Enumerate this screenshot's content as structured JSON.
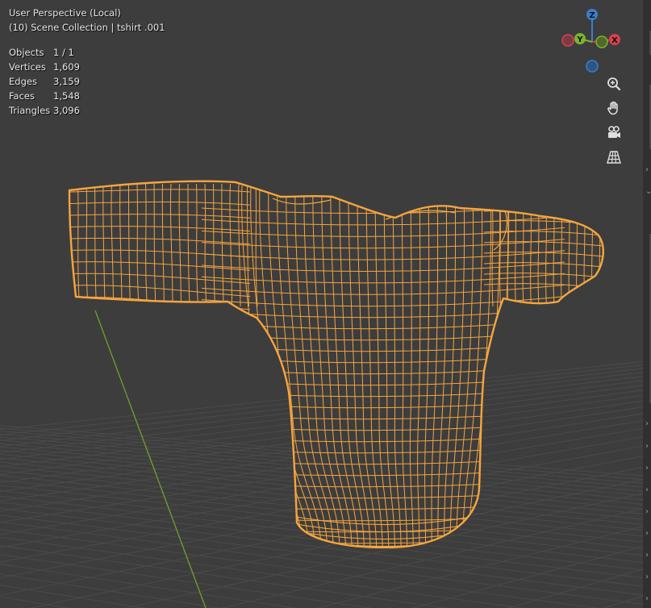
{
  "viewport": {
    "view_name": "User Perspective (Local)",
    "collection_info": "(10) Scene Collection | tshirt .001"
  },
  "stats": [
    {
      "label": "Objects",
      "value": "1 / 1"
    },
    {
      "label": "Vertices",
      "value": "1,609"
    },
    {
      "label": "Edges",
      "value": "3,159"
    },
    {
      "label": "Faces",
      "value": "1,548"
    },
    {
      "label": "Triangles",
      "value": "3,096"
    }
  ],
  "gizmo": {
    "z_label": "Z",
    "y_label": "Y",
    "x_label": "X",
    "colors": {
      "x": "#d9404f",
      "y": "#7db42c",
      "z": "#3a7ed1"
    }
  },
  "navigation": {
    "icons": [
      "zoom-icon",
      "hand-pan-icon",
      "camera-icon",
      "grid-icon"
    ]
  },
  "colors": {
    "background": "#3d3d3d",
    "wireframe": "#f6a53e",
    "floor_grid": "#4a4a4a",
    "y_axis_line": "#6e9a2d"
  }
}
